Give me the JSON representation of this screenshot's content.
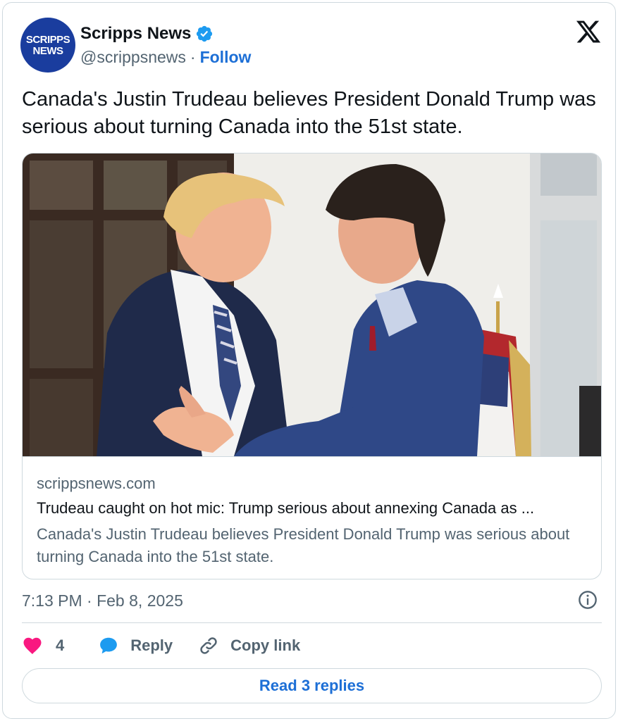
{
  "author": {
    "avatar_line1": "SCRIPPS",
    "avatar_line2": "NEWS",
    "name": "Scripps News",
    "handle": "@scrippsnews",
    "separator": "·",
    "follow_label": "Follow"
  },
  "tweet": {
    "text": "Canada's Justin Trudeau believes President Donald Trump was serious about turning Canada into the 51st state.",
    "timestamp": "7:13 PM · Feb 8, 2025"
  },
  "link_card": {
    "domain": "scrippsnews.com",
    "title": "Trudeau caught on hot mic: Trump serious about annexing Canada as ...",
    "description": "Canada's Justin Trudeau believes President Donald Trump was serious about turning Canada into the 51st state."
  },
  "actions": {
    "like_count": "4",
    "reply_label": "Reply",
    "copy_label": "Copy link",
    "read_replies_label": "Read 3 replies"
  },
  "icons": [
    "verified-badge-icon",
    "x-logo-icon",
    "info-icon",
    "heart-icon",
    "reply-bubble-icon",
    "link-icon"
  ],
  "colors": {
    "accent": "#1d6fd6",
    "verified": "#1d9bf0",
    "like": "#f91880",
    "avatar_bg": "#1a3d9e",
    "secondary_text": "#536471"
  }
}
